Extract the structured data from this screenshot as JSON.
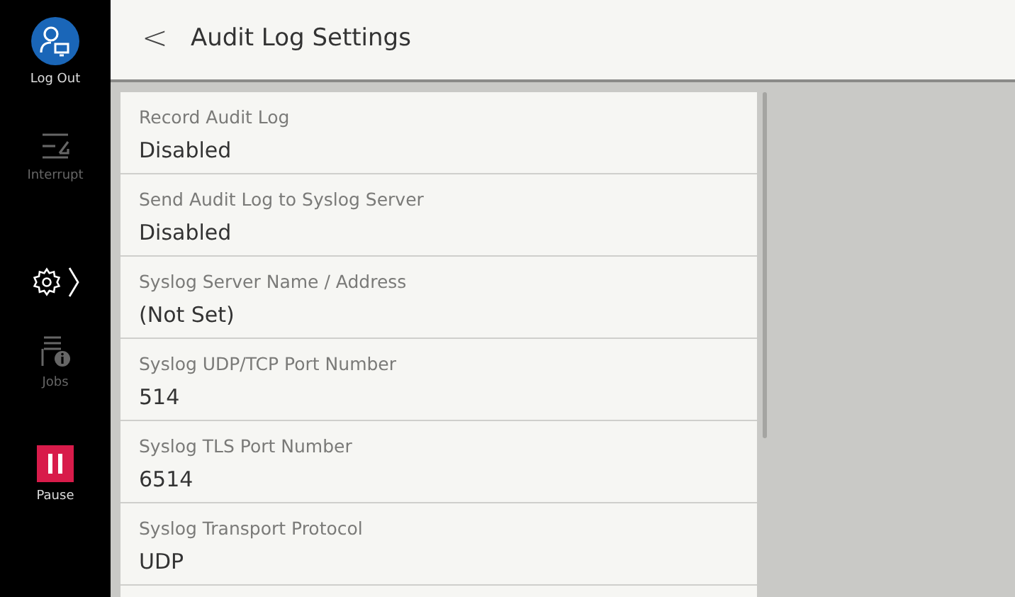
{
  "sidebar": {
    "items": [
      {
        "kind": "logout",
        "label": "Log Out",
        "disabled": false
      },
      {
        "kind": "interrupt",
        "label": "Interrupt",
        "disabled": true
      },
      {
        "kind": "settings",
        "selected": true
      },
      {
        "kind": "jobs",
        "label": "Jobs",
        "disabled": true
      },
      {
        "kind": "pause",
        "label": "Pause",
        "disabled": false
      }
    ]
  },
  "header": {
    "back": "<",
    "title": "Audit Log Settings"
  },
  "settings": [
    {
      "label": "Record Audit Log",
      "value": "Disabled"
    },
    {
      "label": "Send Audit Log to Syslog Server",
      "value": "Disabled"
    },
    {
      "label": "Syslog Server Name / Address",
      "value": "(Not Set)"
    },
    {
      "label": "Syslog UDP/TCP Port Number",
      "value": "514"
    },
    {
      "label": "Syslog TLS Port Number",
      "value": "6514"
    },
    {
      "label": "Syslog Transport Protocol",
      "value": "UDP"
    }
  ]
}
